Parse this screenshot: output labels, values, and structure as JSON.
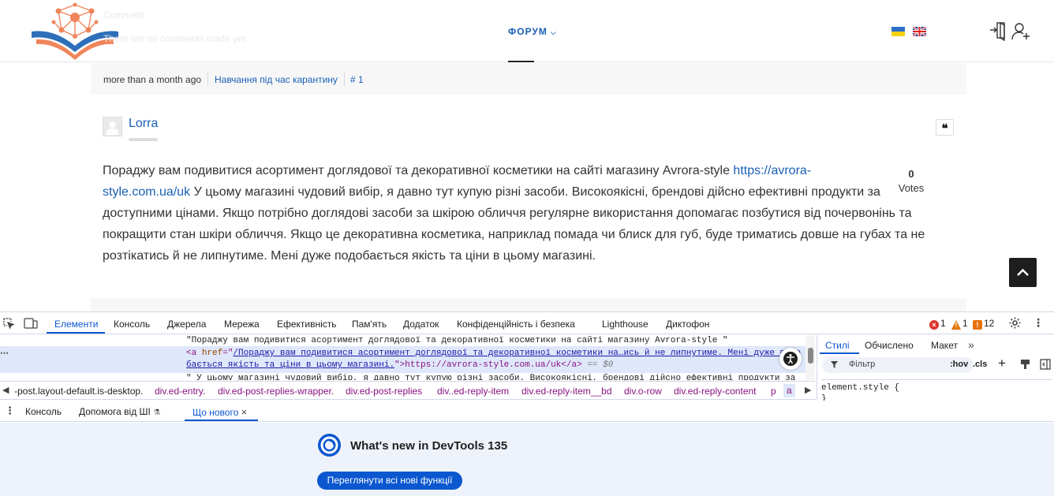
{
  "header": {
    "ghost_title": "Comment",
    "ghost_text": "There are no comments made yet",
    "nav_forum": "ФОРУМ",
    "colors": {
      "accent": "#1a5fb4",
      "logo_orange": "#f0855b",
      "logo_blue": "#2d6fb8"
    }
  },
  "meta": {
    "time": "more than a month ago",
    "topic": "Навчання під час карантину",
    "post_number": "# 1"
  },
  "post": {
    "author": "Lorra",
    "quote_symbol": "❝",
    "text_before": "Пораджу вам подивитися асортимент доглядової та декоративної косметики на сайті магазину Avrora-style ",
    "link_line1": "https://avrora-",
    "link_line2": "style.com.ua/uk",
    "text_after": " У цьому магазині чудовий вибір, я давно тут купую різні засоби. Високоякісні, брендові дійсно ефективні продукти за доступними цінами. Якщо потрібно доглядові засоби за шкірою обличчя регулярне використання допомагає позбутися від почервонінь та покращити стан шкіри обличчя. Якщо це декоративна косметика, наприклад помада чи блиск для губ, буде триматись довше на губах та не розтікатись й не липнутиме. Мені дуже подобається якість та ціни в цьому магазині.",
    "votes_count": "0",
    "votes_label": "Votes"
  },
  "devtools": {
    "tabs": [
      "Елементи",
      "Консоль",
      "Джерела",
      "Мережа",
      "Ефективність",
      "Пам'ять",
      "Додаток",
      "Конфіденційність і безпека",
      "Lighthouse",
      "Диктофон"
    ],
    "errors": "1",
    "warnings": "1",
    "issues": "12",
    "elements": {
      "line1": "\"Пораджу вам подивитися асортимент доглядової та декоративної косметики на сайті магазину Avrora-style \"",
      "line2_tag_open": "<a ",
      "line2_attr": "href",
      "line2_eq": "=\"",
      "line2_val": "/Пораджу вам подивитися асортимент доглядової та декоративної косметики на…ись й не липнутиме. Мені дуже подо",
      "line3_val": "бається якість та ціни в цьому магазині.",
      "line3_rest": "\">https://avrora-style.com.ua/uk",
      "line3_close": "</a>",
      "line3_eq": " == $0",
      "line4": "\" У цьому магазині чудовий вибір, я давно тут купую різні засоби. Високоякісні, брендові дійсно ефективні продукти за",
      "row_dots": "⋯"
    },
    "breadcrumbs": [
      "-post.layout-default.is-desktop.",
      "div.ed-entry.",
      "div.ed-post-replies-wrapper.",
      "div.ed-post-replies",
      "div..ed-reply-item",
      "div.ed-reply-item__bd",
      "div.o-row",
      "div.ed-reply-content",
      "p",
      "a"
    ],
    "styles": {
      "tabs": [
        "Стилі",
        "Обчислено",
        "Макет"
      ],
      "more": "»",
      "filter_placeholder": "Фільтр",
      "hov": ":hov",
      "cls": ".cls",
      "plus": "+",
      "rule_line1": "element.style {",
      "rule_line2": "}"
    },
    "drawer_tabs": [
      "Консоль",
      "Допомога від ШІ",
      "Що нового"
    ],
    "drawer_ai_flask": "⚗",
    "drawer_close": "×",
    "whats_new_title": "What's new in DevTools 135",
    "whats_new_button": "Переглянути всі нові функції",
    "colors": {
      "accent": "#0b57d0",
      "error": "#dc362e",
      "warning": "#e37400",
      "issue": "#e8710a"
    }
  }
}
